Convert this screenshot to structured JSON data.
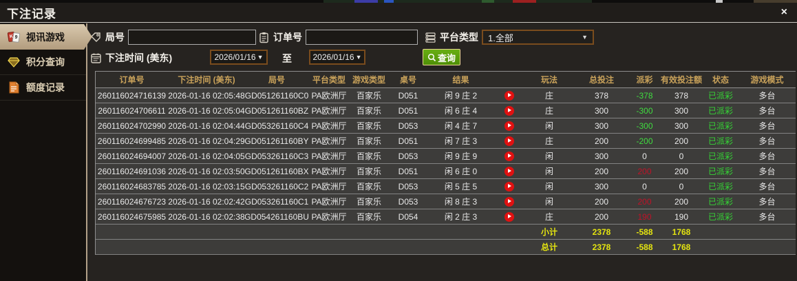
{
  "window": {
    "title": "下注记录",
    "close_label": "×"
  },
  "sidebar": {
    "items": [
      {
        "label": "视讯游戏",
        "icon": "playing-cards-icon",
        "active": true
      },
      {
        "label": "积分查询",
        "icon": "gem-icon",
        "active": false
      },
      {
        "label": "额度记录",
        "icon": "document-icon",
        "active": false
      }
    ]
  },
  "filters": {
    "round_label": "局号",
    "round_value": "",
    "round_icon": "tag-icon",
    "order_label": "订单号",
    "order_value": "",
    "order_icon": "clipboard-icon",
    "platform_label": "平台类型",
    "platform_value": "1.全部",
    "platform_icon": "list-icon",
    "dropdown_arrow": "▼",
    "time_label": "下注时间 (美东)",
    "time_icon": "calendar-icon",
    "date_from": "2026/01/16",
    "date_to": "2026/01/16",
    "date_arrow": "▼",
    "to_label": "至",
    "search_label": "查询",
    "search_icon": "magnifier-icon"
  },
  "table": {
    "headers": [
      "订单号",
      "下注时间 (美东)",
      "局号",
      "平台类型",
      "游戏类型",
      "桌号",
      "结果",
      "",
      "玩法",
      "总投注",
      "派彩",
      "有效投注额",
      "状态",
      "游戏模式"
    ],
    "rows": [
      {
        "order": "260116024716139",
        "time": "2026-01-16 02:05:48",
        "round": "GD051261160C0",
        "platform": "PA欧洲厅",
        "game": "百家乐",
        "table_no": "D051",
        "result": "闲 9 庄 2",
        "bet_type": "庄",
        "total": "378",
        "payout": "-378",
        "payout_class": "neg",
        "valid": "378",
        "status": "已派彩",
        "mode": "多台"
      },
      {
        "order": "260116024706611",
        "time": "2026-01-16 02:05:04",
        "round": "GD051261160BZ",
        "platform": "PA欧洲厅",
        "game": "百家乐",
        "table_no": "D051",
        "result": "闲 6 庄 4",
        "bet_type": "庄",
        "total": "300",
        "payout": "-300",
        "payout_class": "neg",
        "valid": "300",
        "status": "已派彩",
        "mode": "多台"
      },
      {
        "order": "260116024702990",
        "time": "2026-01-16 02:04:44",
        "round": "GD053261160C4",
        "platform": "PA欧洲厅",
        "game": "百家乐",
        "table_no": "D053",
        "result": "闲 4 庄 7",
        "bet_type": "闲",
        "total": "300",
        "payout": "-300",
        "payout_class": "neg",
        "valid": "300",
        "status": "已派彩",
        "mode": "多台"
      },
      {
        "order": "260116024699485",
        "time": "2026-01-16 02:04:29",
        "round": "GD051261160BY",
        "platform": "PA欧洲厅",
        "game": "百家乐",
        "table_no": "D051",
        "result": "闲 7 庄 3",
        "bet_type": "庄",
        "total": "200",
        "payout": "-200",
        "payout_class": "neg",
        "valid": "200",
        "status": "已派彩",
        "mode": "多台"
      },
      {
        "order": "260116024694007",
        "time": "2026-01-16 02:04:05",
        "round": "GD053261160C3",
        "platform": "PA欧洲厅",
        "game": "百家乐",
        "table_no": "D053",
        "result": "闲 9 庄 9",
        "bet_type": "闲",
        "total": "300",
        "payout": "0",
        "payout_class": "zero",
        "valid": "0",
        "status": "已派彩",
        "mode": "多台"
      },
      {
        "order": "260116024691036",
        "time": "2026-01-16 02:03:50",
        "round": "GD051261160BX",
        "platform": "PA欧洲厅",
        "game": "百家乐",
        "table_no": "D051",
        "result": "闲 6 庄 0",
        "bet_type": "闲",
        "total": "200",
        "payout": "200",
        "payout_class": "pos",
        "valid": "200",
        "status": "已派彩",
        "mode": "多台"
      },
      {
        "order": "260116024683785",
        "time": "2026-01-16 02:03:15",
        "round": "GD053261160C2",
        "platform": "PA欧洲厅",
        "game": "百家乐",
        "table_no": "D053",
        "result": "闲 5 庄 5",
        "bet_type": "闲",
        "total": "300",
        "payout": "0",
        "payout_class": "zero",
        "valid": "0",
        "status": "已派彩",
        "mode": "多台"
      },
      {
        "order": "260116024676723",
        "time": "2026-01-16 02:02:42",
        "round": "GD053261160C1",
        "platform": "PA欧洲厅",
        "game": "百家乐",
        "table_no": "D053",
        "result": "闲 8 庄 3",
        "bet_type": "闲",
        "total": "200",
        "payout": "200",
        "payout_class": "pos",
        "valid": "200",
        "status": "已派彩",
        "mode": "多台"
      },
      {
        "order": "260116024675985",
        "time": "2026-01-16 02:02:38",
        "round": "GD054261160BU",
        "platform": "PA欧洲厅",
        "game": "百家乐",
        "table_no": "D054",
        "result": "闲 2 庄 3",
        "bet_type": "庄",
        "total": "200",
        "payout": "190",
        "payout_class": "pos",
        "valid": "190",
        "status": "已派彩",
        "mode": "多台"
      }
    ],
    "subtotal": {
      "label": "小计",
      "total": "2378",
      "payout": "-588",
      "valid": "1768"
    },
    "grand_total": {
      "label": "总计",
      "total": "2378",
      "payout": "-588",
      "valid": "1768"
    }
  },
  "colors": {
    "active_tab": "#c8b596",
    "header_text": "#c9a25a",
    "payout_negative": "#3fdc3f",
    "payout_positive": "#c01228",
    "status_paid": "#35d435",
    "summary_yellow": "#e4e410",
    "search_button": "#5a9e0d",
    "date_border": "#7a4c1d"
  }
}
